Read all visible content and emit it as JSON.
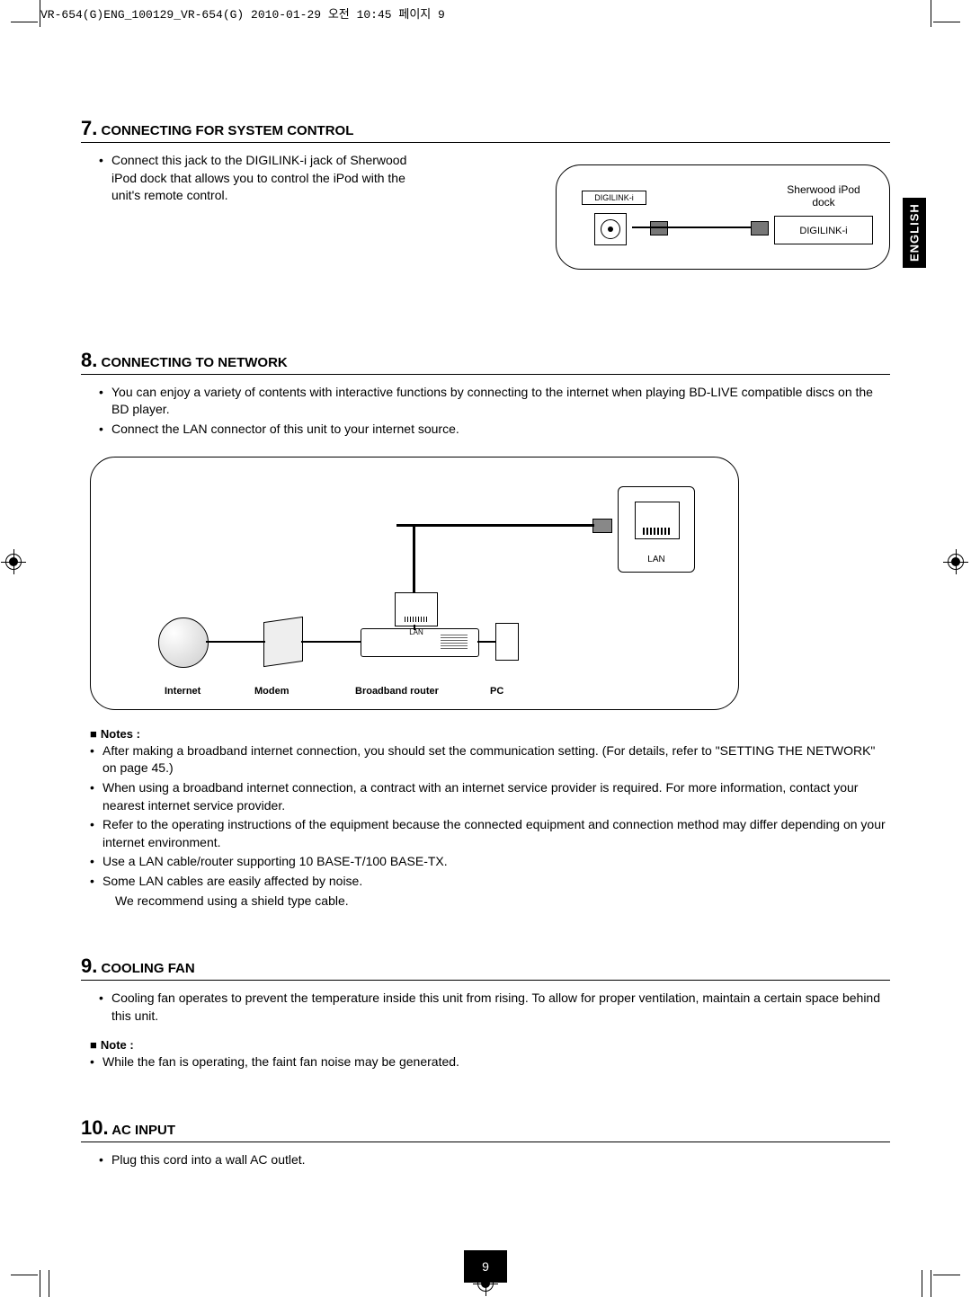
{
  "header": "VR-654(G)ENG_100129_VR-654(G)  2010-01-29  오전 10:45  페이지 9",
  "languageTab": "ENGLISH",
  "pageNumber": "9",
  "section7": {
    "number": "7.",
    "title": "CONNECTING FOR SYSTEM CONTROL",
    "bullet": "Connect this jack to the DIGILINK-i jack of Sherwood iPod dock that allows you to control the iPod with the unit's remote control.",
    "diagram": {
      "jackLabel": "DIGILINK-i",
      "dockTitle": "Sherwood iPod dock",
      "dockJack": "DIGILINK-i"
    }
  },
  "section8": {
    "number": "8.",
    "title": "CONNECTING TO NETWORK",
    "bullets": [
      "You can enjoy a variety of contents with interactive functions by connecting to the internet when playing BD-LIVE compatible discs on the BD player.",
      "Connect the LAN connector of this unit to your internet source."
    ],
    "diagram": {
      "lanPanel": "LAN",
      "rj45": "LAN",
      "row": {
        "internet": "Internet",
        "modem": "Modem",
        "router": "Broadband router",
        "pc": "PC"
      }
    },
    "notesLabel": "Notes :",
    "notes": [
      "After making a broadband internet connection, you should set the communication setting. (For details, refer to \"SETTING THE NETWORK\" on page 45.)",
      "When using a broadband internet connection, a contract with an internet service provider is required. For more information, contact your nearest internet service provider.",
      "Refer to the operating instructions of the equipment because the connected equipment and connection method may differ depending on your internet environment.",
      "Use a LAN cable/router supporting 10 BASE-T/100 BASE-TX.",
      "Some LAN cables are easily affected by noise.",
      "We recommend using a shield type cable."
    ]
  },
  "section9": {
    "number": "9.",
    "title": "COOLING FAN",
    "bullet": "Cooling fan operates to prevent the temperature inside this unit from rising. To allow for proper ventilation, maintain a certain space behind this unit.",
    "noteLabel": "Note :",
    "note": "While the fan is operating, the faint fan noise may be generated."
  },
  "section10": {
    "number": "10.",
    "title": "AC INPUT",
    "bullet": "Plug this cord into a wall AC outlet."
  }
}
